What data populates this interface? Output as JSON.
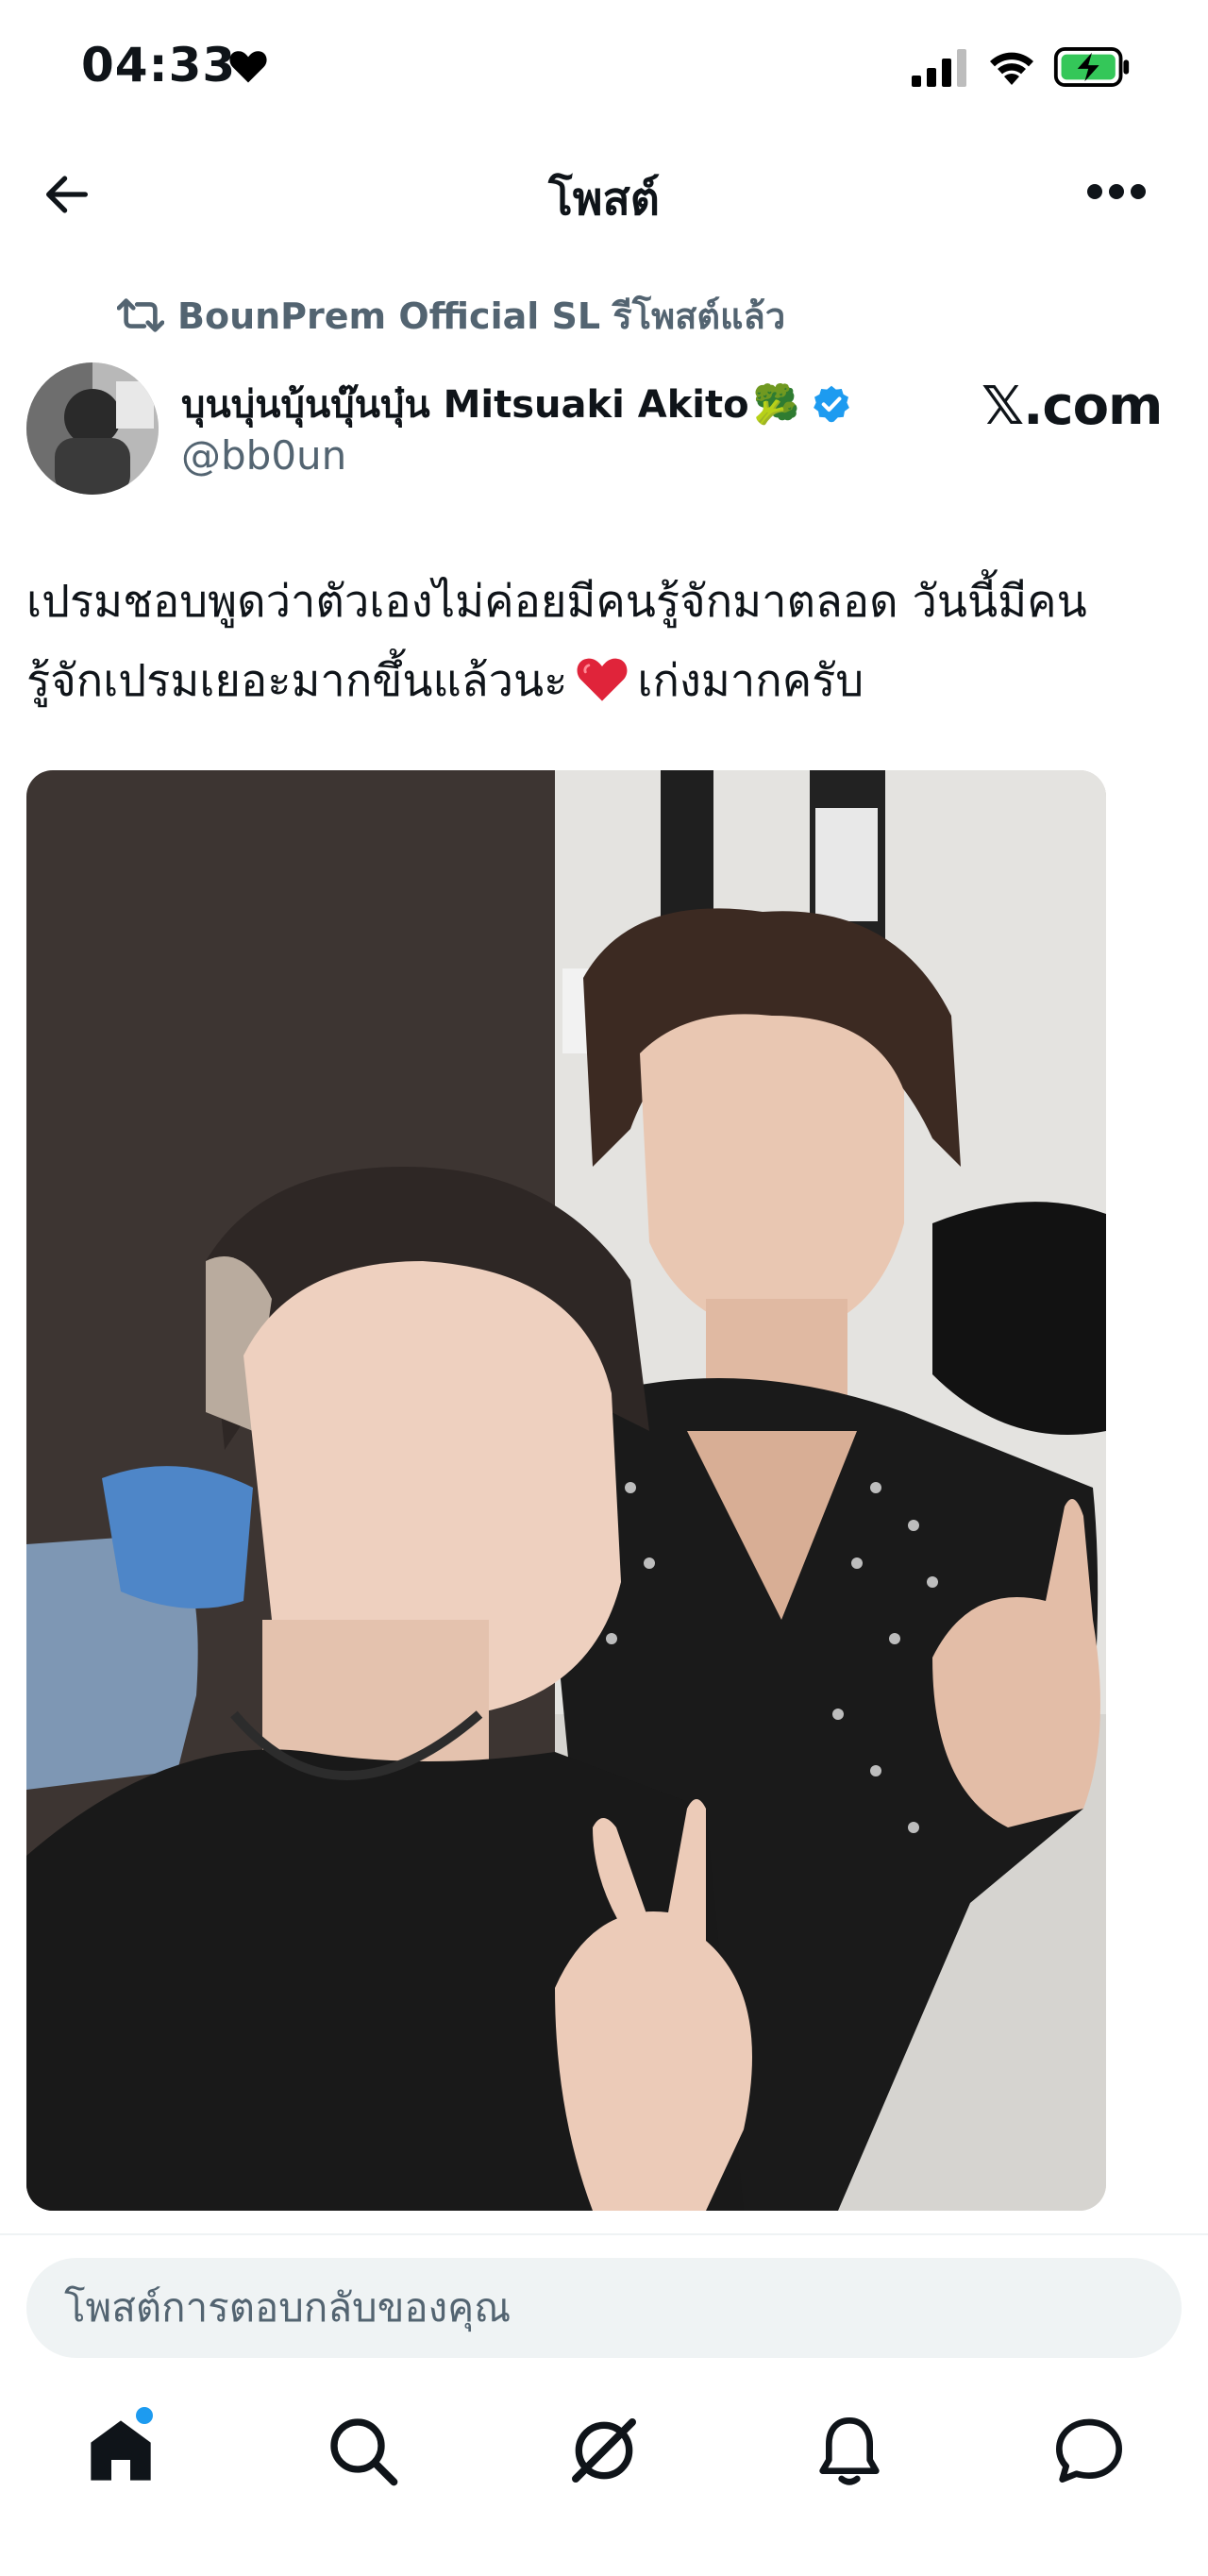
{
  "status_bar": {
    "time": "04:33",
    "icons": [
      "heart-icon",
      "signal-icon",
      "wifi-icon",
      "battery-charging-icon"
    ]
  },
  "header": {
    "title": "โพสต์",
    "icons": [
      "back-arrow-icon",
      "more-icon"
    ]
  },
  "repost": {
    "text": "BounPrem Official SL รีโพสต์แล้ว",
    "icon": "repost-icon"
  },
  "author": {
    "name": "บุนบุ่นบุ้นบุ๊นบุ๋น Mitsuaki Akito",
    "emoji": "🥦",
    "handle": "@bb0un",
    "verified": true
  },
  "watermark": "𝕏.com",
  "post": {
    "line1": "เปรมชอบพูดว่าตัวเองไม่ค่อยมีคนรู้จักมาตลอด วันนี้มีคน",
    "line2_before": "รู้จักเปรมเยอะมากขึ้นแล้วนะ",
    "line2_after": "เก่งมากครับ",
    "emoji_icon": "red-heart-icon"
  },
  "reply": {
    "placeholder": "โพสต์การตอบกลับของคุณ"
  },
  "bottom_nav": {
    "items": [
      "home-icon",
      "search-icon",
      "grok-icon",
      "notifications-icon",
      "messages-icon"
    ],
    "home_has_notification_dot": true
  },
  "colors": {
    "text": "#0f1419",
    "secondary": "#536471",
    "accent": "#1d9bf0",
    "reply_bg": "#eff3f4"
  }
}
